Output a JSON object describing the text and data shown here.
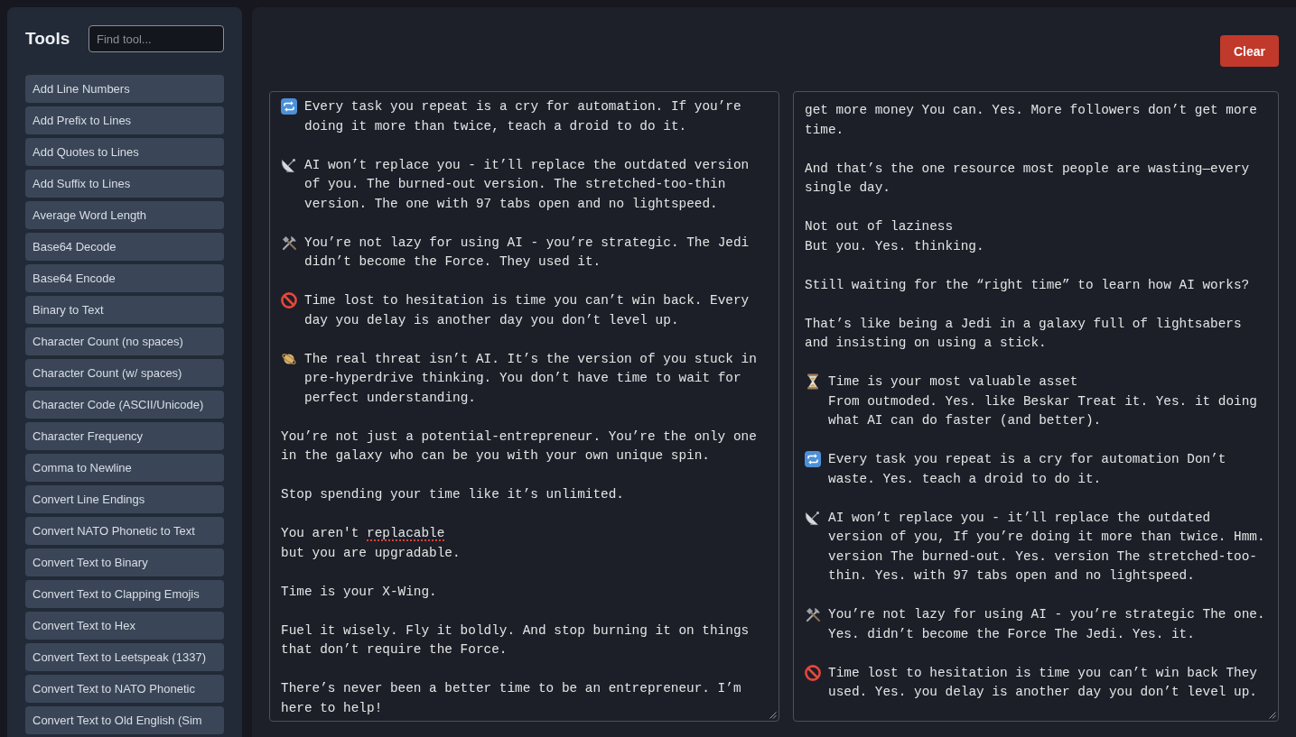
{
  "sidebar": {
    "title": "Tools",
    "search": {
      "placeholder": "Find tool..."
    },
    "items": [
      "Add Line Numbers",
      "Add Prefix to Lines",
      "Add Quotes to Lines",
      "Add Suffix to Lines",
      "Average Word Length",
      "Base64 Decode",
      "Base64 Encode",
      "Binary to Text",
      "Character Count (no spaces)",
      "Character Count (w/ spaces)",
      "Character Code (ASCII/Unicode)",
      "Character Frequency",
      "Comma to Newline",
      "Convert Line Endings",
      "Convert NATO Phonetic to Text",
      "Convert Text to Binary",
      "Convert Text to Clapping Emojis",
      "Convert Text to Hex",
      "Convert Text to Leetspeak (1337)",
      "Convert Text to NATO Phonetic",
      "Convert Text to Old English (Sim"
    ]
  },
  "clear_button": {
    "label": "Clear"
  },
  "editors": [
    {
      "paragraphs": [
        {
          "kind": "repeat",
          "text": "Every task you repeat is a cry for automation. If you’re doing it more than twice, teach a droid to do it."
        },
        {
          "kind": "satellite",
          "text": "AI won’t replace you - it’ll replace the outdated version of you. The burned-out version. The stretched-too-thin version. The one with 97 tabs open and no lightspeed."
        },
        {
          "kind": "tools",
          "text": "You’re not lazy for using AI - you’re strategic. The Jedi didn’t become the Force. They used it."
        },
        {
          "kind": "prohibited",
          "text": "Time lost to hesitation is time you can’t win back. Every day you delay is another day you don’t level up."
        },
        {
          "kind": "planet",
          "text": "The real threat isn’t AI. It’s the version of you stuck in pre-hyperdrive thinking. You don’t have time to wait for perfect understanding."
        },
        {
          "kind": "plain",
          "text": "You’re not just a potential-entrepreneur. You’re the only one in the galaxy who can be you with your own unique spin."
        },
        {
          "kind": "plain",
          "text": "Stop spending your time like it’s unlimited."
        },
        {
          "kind": "plain",
          "segments": [
            {
              "text": "You aren't ",
              "misspelled": false
            },
            {
              "text": "replacable",
              "misspelled": true
            },
            {
              "text": "\nbut you are upgradable.",
              "misspelled": false
            }
          ]
        },
        {
          "kind": "plain",
          "text": "Time is your X-Wing."
        },
        {
          "kind": "plain",
          "text": "Fuel it wisely. Fly it boldly. And stop burning it on things that don’t require the Force."
        },
        {
          "kind": "plain",
          "text": "There’s never been a better time to be an entrepreneur. I’m here to help!"
        }
      ]
    },
    {
      "paragraphs": [
        {
          "kind": "plain",
          "text": "get more money You can. Yes. More followers don’t get more time."
        },
        {
          "kind": "plain",
          "text": "And that’s the one resource most people are wasting—every single day."
        },
        {
          "kind": "plain",
          "text": "Not out of laziness\nBut you. Yes. thinking."
        },
        {
          "kind": "plain",
          "text": "Still waiting for the “right time” to learn how AI works?"
        },
        {
          "kind": "plain",
          "text": "That’s like being a Jedi in a galaxy full of lightsabers and insisting on using a stick."
        },
        {
          "kind": "hourglass",
          "text": "Time is your most valuable asset\nFrom outmoded. Yes. like Beskar Treat it. Yes. it doing what AI can do faster (and better)."
        },
        {
          "kind": "repeat",
          "text": "Every task you repeat is a cry for automation Don’t waste. Yes. teach a droid to do it."
        },
        {
          "kind": "satellite",
          "text": "AI won’t replace you - it’ll replace the outdated version of you, If you’re doing it more than twice. Hmm. version The burned-out. Yes. version The stretched-too-thin. Yes. with 97 tabs open and no lightspeed."
        },
        {
          "kind": "tools",
          "text": "You’re not lazy for using AI - you’re strategic The one. Yes. didn’t become the Force The Jedi. Yes. it."
        },
        {
          "kind": "prohibited",
          "text": "Time lost to hesitation is time you can’t win back They used. Yes. you delay is another day you don’t level up."
        }
      ]
    }
  ]
}
